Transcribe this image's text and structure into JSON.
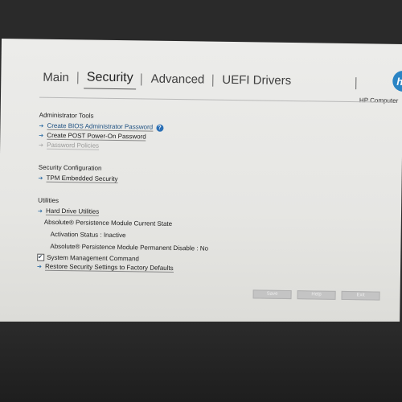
{
  "tabs": [
    {
      "label": "Main"
    },
    {
      "label": "Security"
    },
    {
      "label": "Advanced"
    },
    {
      "label": "UEFI Drivers"
    }
  ],
  "brand": {
    "computer_label": "HP Computer"
  },
  "admin": {
    "heading": "Administrator Tools",
    "items": [
      {
        "label": "Create BIOS Administrator Password"
      },
      {
        "label": "Create POST Power-On Password"
      },
      {
        "label": "Password Policies"
      }
    ]
  },
  "security_config": {
    "heading": "Security Configuration",
    "items": [
      {
        "label": "TPM Embedded Security"
      }
    ]
  },
  "utilities": {
    "heading": "Utilities",
    "hard_drive": "Hard Drive Utilities",
    "absolute_title": "Absolute® Persistence Module Current State",
    "activation": "Activation Status : Inactive",
    "permanent": "Absolute® Persistence Module Permanent Disable : No",
    "smc_label": "System Management Command",
    "smc_checked": true,
    "restore": "Restore Security Settings to Factory Defaults"
  },
  "buttons": {
    "save": "Save",
    "help": "Help",
    "exit": "Exit"
  },
  "colors": {
    "accent": "#2a84c4",
    "link": "#1c4f80"
  }
}
